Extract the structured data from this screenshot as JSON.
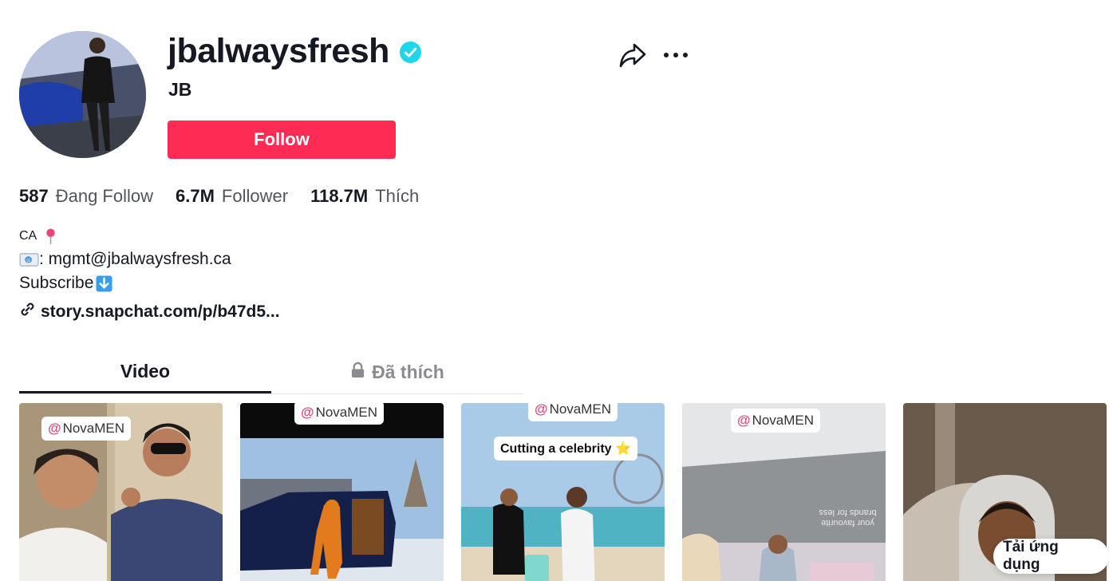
{
  "profile": {
    "username": "jbalwaysfresh",
    "nickname": "JB",
    "follow_label": "Follow",
    "verified_icon": "verified-check-icon"
  },
  "stats": [
    {
      "value": "587",
      "label": "Đang Follow"
    },
    {
      "value": "6.7M",
      "label": "Follower"
    },
    {
      "value": "118.7M",
      "label": "Thích"
    }
  ],
  "bio": {
    "location": "CA",
    "email_line": ": mgmt@jbalwaysfresh.ca",
    "subscribe": "Subscribe"
  },
  "link": {
    "text": "story.snapchat.com/p/b47d5...",
    "icon": "link-icon"
  },
  "tabs": [
    {
      "label": "Video",
      "active": true
    },
    {
      "label": "Đã thích",
      "active": false,
      "icon": "lock-icon"
    }
  ],
  "videos": [
    {
      "tag_at": "@",
      "tag_text": "NovaMEN"
    },
    {
      "tag_at": "@",
      "tag_text": "NovaMEN"
    },
    {
      "tag_at": "@",
      "tag_text": "NovaMEN",
      "caption": "Cutting a celebrity ⭐"
    },
    {
      "tag_at": "@",
      "tag_text": "NovaMEN",
      "sign_text": "your favourite brands for less"
    },
    {}
  ],
  "download_app": "Tải ứng dụng",
  "colors": {
    "follow_button": "#fe2c55",
    "verified": "#20d5ec",
    "text_primary": "#161823"
  }
}
